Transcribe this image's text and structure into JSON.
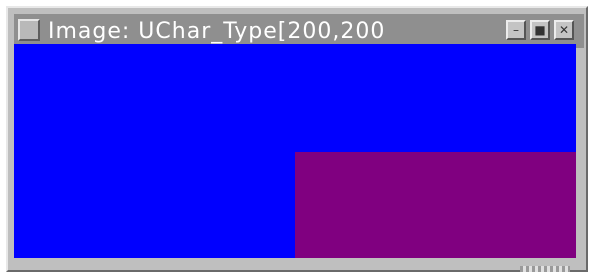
{
  "window": {
    "title": "Image: UChar_Type[200,200",
    "buttons": {
      "minimize_glyph": "–",
      "maximize_glyph": "■",
      "close_glyph": "✕"
    }
  },
  "image": {
    "background_color": "#0000ff",
    "rect_color": "#800080"
  },
  "icons": [
    "system-menu-icon",
    "minimize-icon",
    "maximize-icon",
    "close-icon"
  ]
}
